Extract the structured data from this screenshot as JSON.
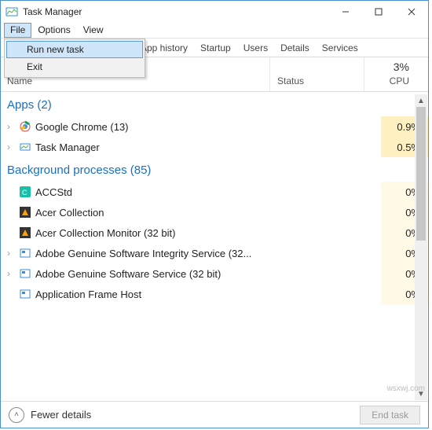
{
  "title": "Task Manager",
  "menus": {
    "file": "File",
    "options": "Options",
    "view": "View"
  },
  "file_dropdown": {
    "run_new_task": "Run new task",
    "exit": "Exit"
  },
  "tabs": {
    "app_history": "App history",
    "startup": "Startup",
    "users": "Users",
    "details": "Details",
    "services": "Services"
  },
  "columns": {
    "name": "Name",
    "status": "Status",
    "cpu": "CPU",
    "cpu_pct": "3%"
  },
  "groups": {
    "apps": "Apps (2)",
    "bg": "Background processes (85)"
  },
  "processes": {
    "apps": [
      {
        "name": "Google Chrome (13)",
        "cpu": "0.9%"
      },
      {
        "name": "Task Manager",
        "cpu": "0.5%"
      }
    ],
    "bg": [
      {
        "name": "ACCStd",
        "cpu": "0%"
      },
      {
        "name": "Acer Collection",
        "cpu": "0%"
      },
      {
        "name": "Acer Collection Monitor (32 bit)",
        "cpu": "0%"
      },
      {
        "name": "Adobe Genuine Software Integrity Service (32...",
        "cpu": "0%"
      },
      {
        "name": "Adobe Genuine Software Service (32 bit)",
        "cpu": "0%"
      },
      {
        "name": "Application Frame Host",
        "cpu": "0%"
      }
    ]
  },
  "footer": {
    "fewer": "Fewer details",
    "end_task": "End task"
  },
  "watermark": "wsxwj.com"
}
